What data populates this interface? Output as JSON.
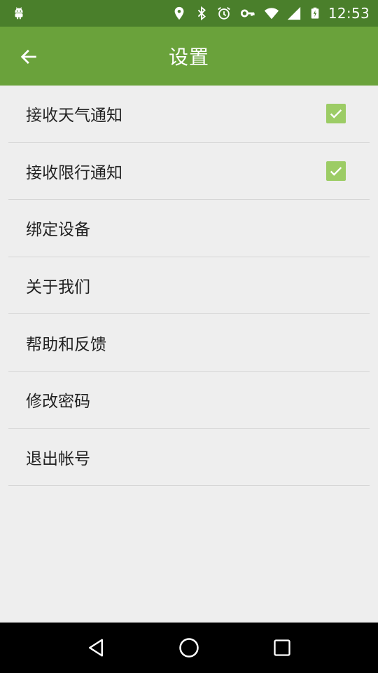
{
  "status_bar": {
    "time": "12:53",
    "icons": [
      "android-icon",
      "location-icon",
      "bluetooth-icon",
      "alarm-icon",
      "vpn-key-icon",
      "wifi-icon",
      "signal-icon",
      "battery-charging-icon"
    ]
  },
  "app_bar": {
    "title": "设置",
    "back_icon": "arrow-left-icon"
  },
  "settings": {
    "items": [
      {
        "label": "接收天气通知",
        "checkbox": true,
        "checked": true
      },
      {
        "label": "接收限行通知",
        "checkbox": true,
        "checked": true
      },
      {
        "label": "绑定设备"
      },
      {
        "label": "关于我们"
      },
      {
        "label": "帮助和反馈"
      },
      {
        "label": "修改密码"
      },
      {
        "label": "退出帐号"
      }
    ]
  },
  "nav_bar": {
    "buttons": [
      "back-triangle-icon",
      "home-circle-icon",
      "recents-square-icon"
    ]
  },
  "colors": {
    "status_bar": "#4a7f2b",
    "app_bar": "#6aa23b",
    "checkbox": "#9ccc65",
    "background": "#eeeeee"
  }
}
